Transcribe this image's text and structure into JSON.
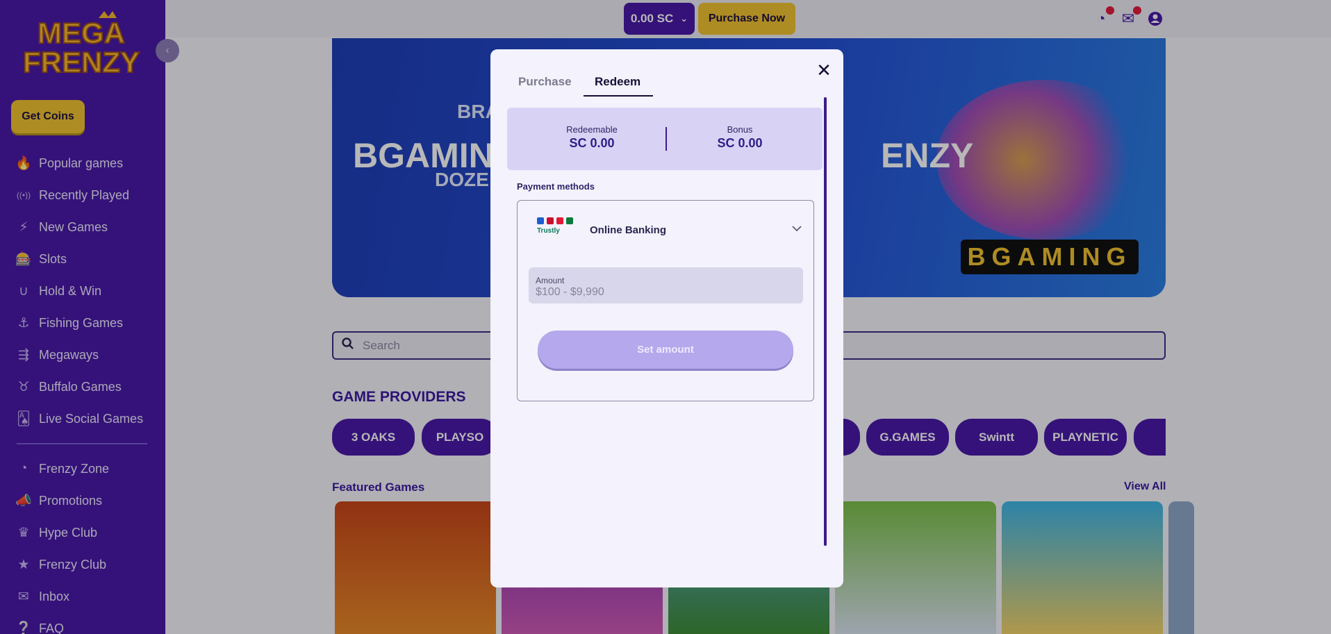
{
  "sidebar": {
    "logo_line1": "MEGA",
    "logo_line2": "FRENZY",
    "get_coins": "Get Coins",
    "items": [
      {
        "label": "Popular games",
        "icon": "flame-icon",
        "glyph": "🔥"
      },
      {
        "label": "Recently Played",
        "icon": "broadcast-icon",
        "glyph": "((•))"
      },
      {
        "label": "New Games",
        "icon": "bolt-icon",
        "glyph": "⚡"
      },
      {
        "label": "Slots",
        "icon": "slot-machine-icon",
        "glyph": "🎰"
      },
      {
        "label": "Hold & Win",
        "icon": "horseshoe-icon",
        "glyph": "∪"
      },
      {
        "label": "Fishing Games",
        "icon": "fishing-icon",
        "glyph": "⚓"
      },
      {
        "label": "Megaways",
        "icon": "megaways-icon",
        "glyph": "⇶"
      },
      {
        "label": "Buffalo Games",
        "icon": "buffalo-icon",
        "glyph": "♉"
      },
      {
        "label": "Live Social Games",
        "icon": "cards-icon",
        "glyph": "🂡"
      },
      {
        "label": "Frenzy Zone",
        "icon": "frenzy-zone-icon",
        "glyph": "◔"
      },
      {
        "label": "Promotions",
        "icon": "megaphone-icon",
        "glyph": "📣"
      },
      {
        "label": "Hype Club",
        "icon": "crown-icon",
        "glyph": "♛"
      },
      {
        "label": "Frenzy Club",
        "icon": "star-icon",
        "glyph": "★"
      },
      {
        "label": "Inbox",
        "icon": "mail-icon",
        "glyph": "✉"
      },
      {
        "label": "FAQ",
        "icon": "faq-icon",
        "glyph": "❔"
      }
    ]
  },
  "header": {
    "balance": "0.00 SC",
    "purchase_now": "Purchase Now"
  },
  "banner": {
    "line1": "BRA",
    "line2": "BGAMIN",
    "line3": "DOZE",
    "line4": "ENZY",
    "brand": "BGAMING"
  },
  "search": {
    "placeholder": "Search"
  },
  "providers": {
    "title": "GAME PROVIDERS",
    "items": [
      "3 OAKS",
      "PLAYSO",
      "",
      "G.GAMES",
      "Swintt",
      "PLAYNETIC",
      ""
    ]
  },
  "featured": {
    "title": "Featured Games",
    "view_all": "View All"
  },
  "modal": {
    "tabs": {
      "purchase": "Purchase",
      "redeem": "Redeem"
    },
    "redeemable_label": "Redeemable",
    "redeemable_value": "SC 0.00",
    "bonus_label": "Bonus",
    "bonus_value": "SC 0.00",
    "payment_methods_label": "Payment methods",
    "payment_method": "Online Banking",
    "trustly": "Trustly",
    "amount_label": "Amount",
    "amount_placeholder": "$100 - $9,990",
    "set_amount": "Set amount"
  },
  "colors": {
    "brand_purple": "#4a1aa8",
    "gold": "#f1c232",
    "set_amount_disabled": "#b5a8ec"
  }
}
